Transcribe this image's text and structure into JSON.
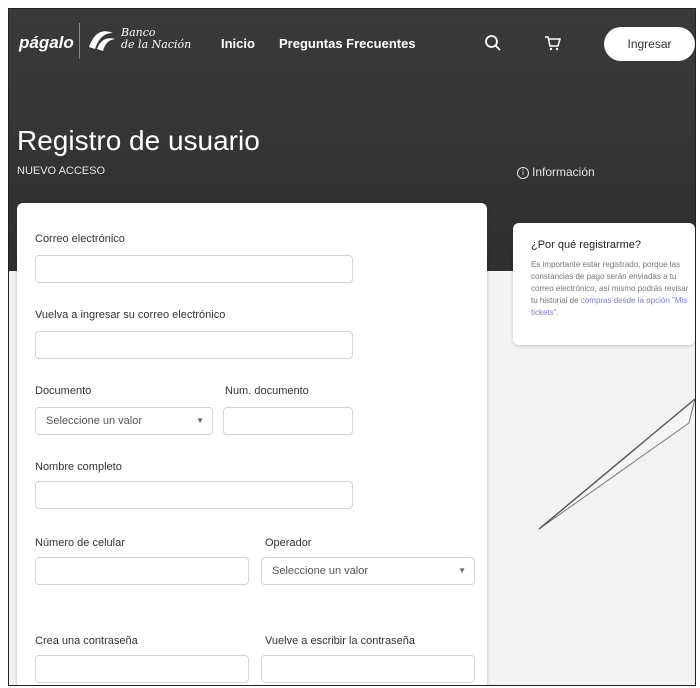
{
  "header": {
    "logo_pagalo": "págalo",
    "bank_name_line1": "Banco",
    "bank_name_line2": "de la Nación",
    "nav_inicio": "Inicio",
    "nav_faq": "Preguntas Frecuentes",
    "login_label": "Ingresar"
  },
  "page": {
    "title": "Registro de usuario",
    "subtitle": "NUEVO ACCESO",
    "info_link": "Información"
  },
  "form": {
    "email_label": "Correo electrónico",
    "email_confirm_label": "Vuelva a ingresar su correo electrónico",
    "document_label": "Documento",
    "document_select_value": "Seleccione un valor",
    "doc_number_label": "Num. documento",
    "fullname_label": "Nombre completo",
    "phone_label": "Número de celular",
    "operator_label": "Operador",
    "operator_select_value": "Seleccione un valor",
    "password_label": "Crea una contraseña",
    "password_confirm_label": "Vuelve a escribir la contraseña"
  },
  "info_card": {
    "title": "¿Por qué registrarme?",
    "body": "Es importante estar registrado, porque las constancias de pago serán enviadas a tu correo electrónico, así mismo podrás revisar tu historial de",
    "body_highlight": "compras desde la opción \"Mis tickets\"."
  },
  "icons": {
    "search": "search-icon",
    "cart": "cart-icon",
    "info": "info-icon",
    "select_arrow": "chevron-down-icon"
  }
}
